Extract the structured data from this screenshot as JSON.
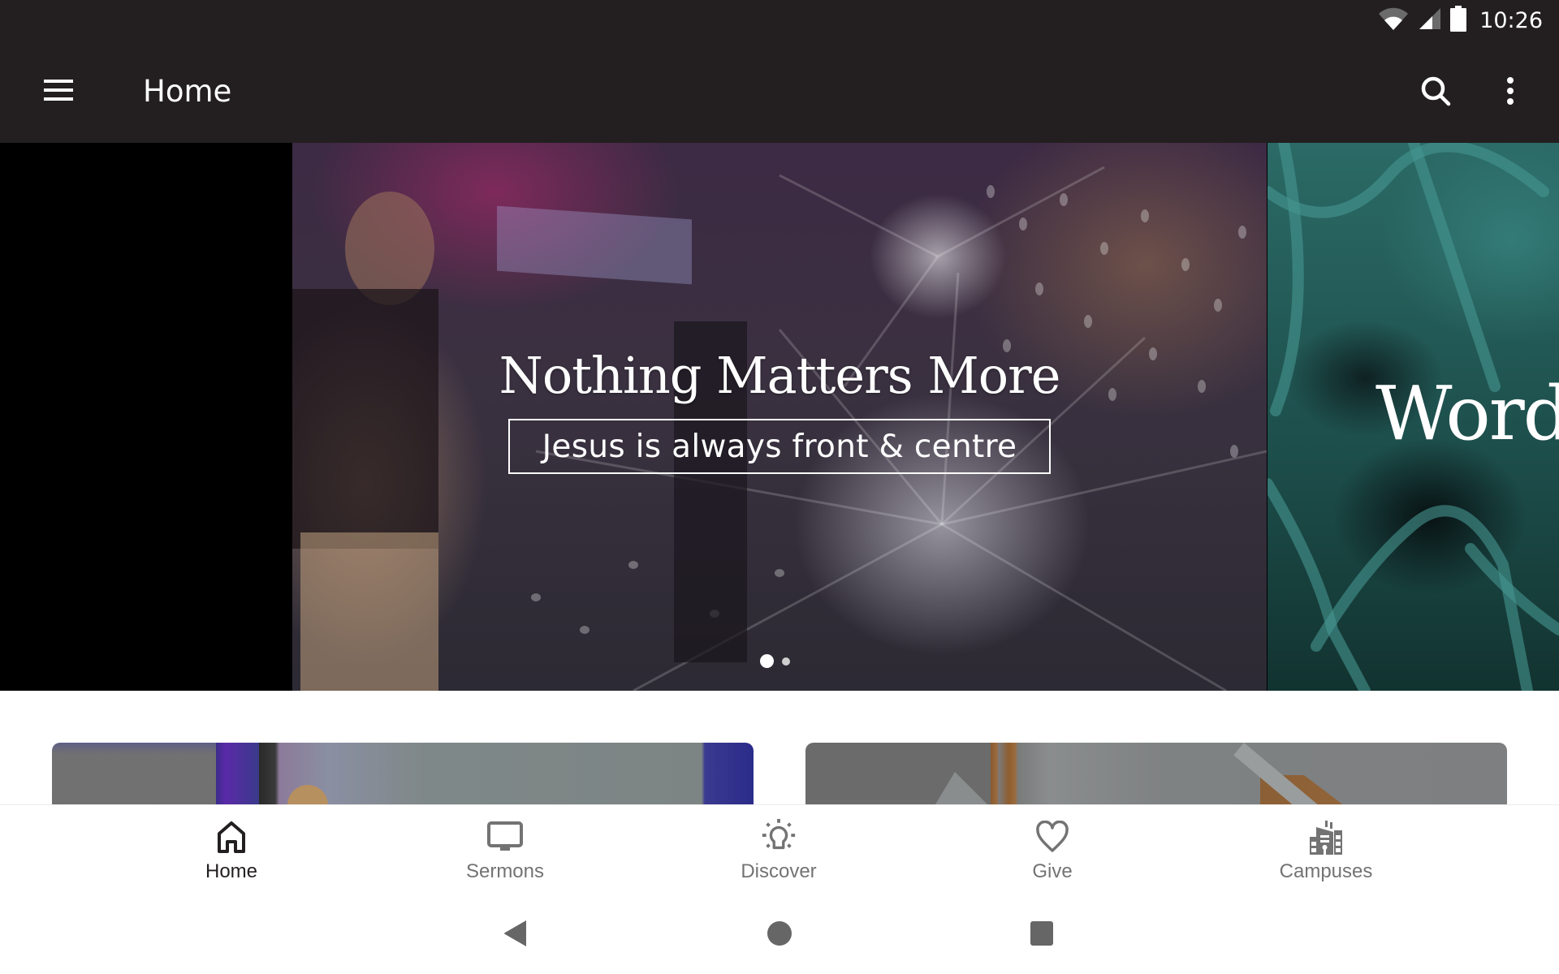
{
  "status_bar": {
    "time": "10:26",
    "icons": [
      "wifi-icon",
      "cell-signal-icon",
      "battery-icon"
    ]
  },
  "app_bar": {
    "title": "Home",
    "menu_icon": "hamburger-menu-icon",
    "search_icon": "search-icon",
    "more_icon": "more-vert-icon"
  },
  "carousel": {
    "slides": [
      {
        "heading": "Nothing Matters More",
        "subheading": "Jesus is always front & centre"
      },
      {
        "heading": "Word"
      }
    ],
    "active_index": 0,
    "total": 2
  },
  "cards": [
    {
      "name": "content-card-1"
    },
    {
      "name": "content-card-2"
    }
  ],
  "bottom_nav": {
    "items": [
      {
        "label": "Home",
        "icon": "home-icon",
        "active": true
      },
      {
        "label": "Sermons",
        "icon": "monitor-icon",
        "active": false
      },
      {
        "label": "Discover",
        "icon": "lightbulb-icon",
        "active": false
      },
      {
        "label": "Give",
        "icon": "heart-icon",
        "active": false
      },
      {
        "label": "Campuses",
        "icon": "buildings-icon",
        "active": false
      }
    ]
  },
  "system_nav": {
    "back_icon": "back-icon",
    "home_icon": "home-circle-icon",
    "recents_icon": "recents-icon"
  },
  "colors": {
    "app_bar": "#231f20",
    "nav_active": "#231f20",
    "nav_inactive": "#737373",
    "system_nav": "#666666"
  }
}
